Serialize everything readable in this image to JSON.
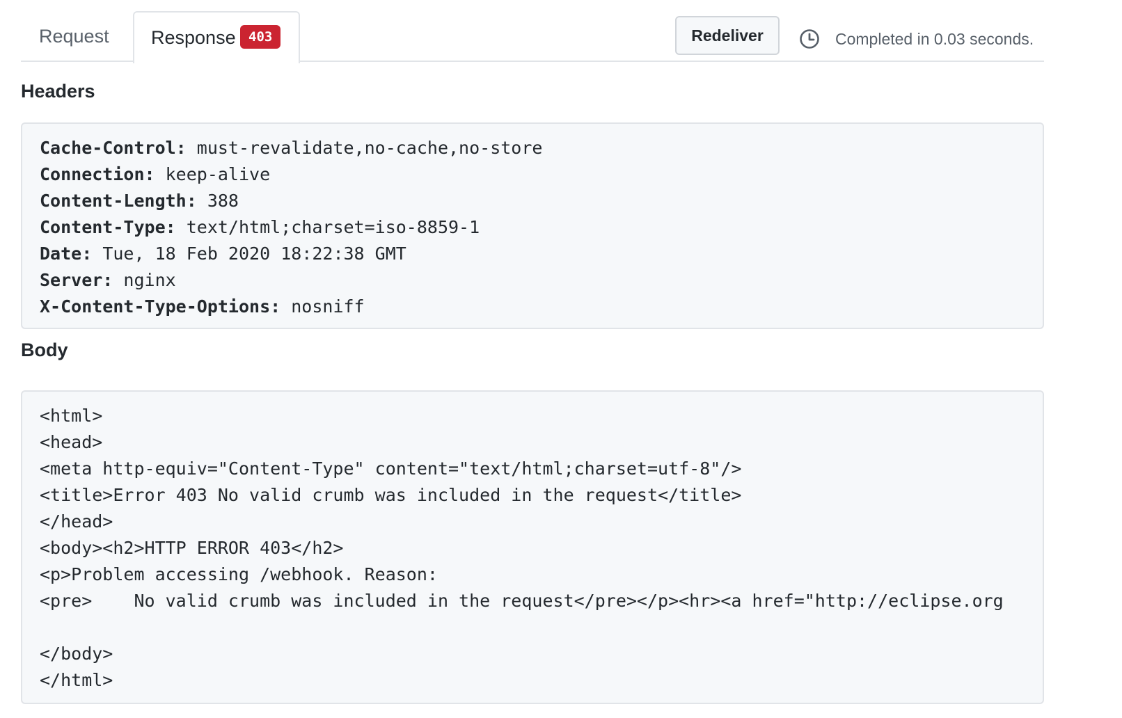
{
  "tabs": {
    "request_label": "Request",
    "response_label": "Response",
    "response_badge": "403"
  },
  "toolbar": {
    "redeliver_label": "Redeliver",
    "status_icon": "clock-icon",
    "completed_text": "Completed in 0.03 seconds."
  },
  "headers_section": {
    "title": "Headers",
    "items": [
      {
        "key": "Cache-Control:",
        "value": " must-revalidate,no-cache,no-store"
      },
      {
        "key": "Connection:",
        "value": " keep-alive"
      },
      {
        "key": "Content-Length:",
        "value": " 388"
      },
      {
        "key": "Content-Type:",
        "value": " text/html;charset=iso-8859-1"
      },
      {
        "key": "Date:",
        "value": " Tue, 18 Feb 2020 18:22:38 GMT"
      },
      {
        "key": "Server:",
        "value": " nginx"
      },
      {
        "key": "X-Content-Type-Options:",
        "value": " nosniff"
      }
    ]
  },
  "body_section": {
    "title": "Body",
    "lines": [
      "<html>",
      "<head>",
      "<meta http-equiv=\"Content-Type\" content=\"text/html;charset=utf-8\"/>",
      "<title>Error 403 No valid crumb was included in the request</title>",
      "</head>",
      "<body><h2>HTTP ERROR 403</h2>",
      "<p>Problem accessing /webhook. Reason:",
      "<pre>    No valid crumb was included in the request</pre></p><hr><a href=\"http://eclipse.org",
      "",
      "</body>",
      "</html>"
    ]
  },
  "colors": {
    "badge_bg": "#cb2431",
    "code_bg": "#f6f8fa",
    "border": "#e1e4e8"
  }
}
